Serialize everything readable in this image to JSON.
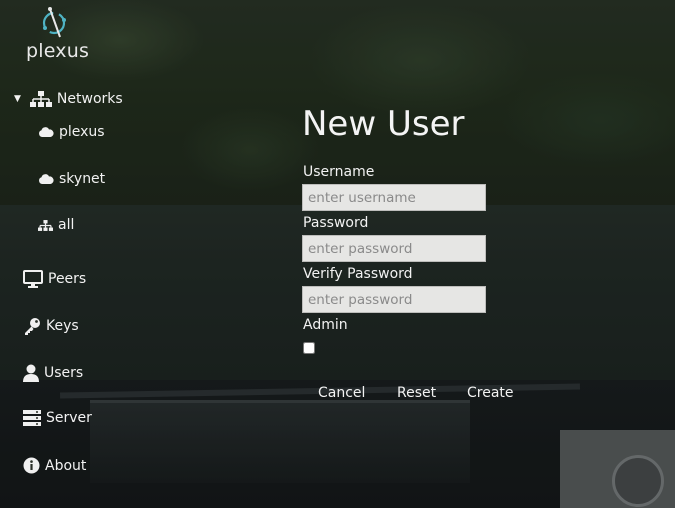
{
  "app": {
    "logo_text": "plexus"
  },
  "sidebar": {
    "networks": {
      "label": "Networks",
      "expanded": true,
      "children": [
        {
          "label": "plexus",
          "icon": "cloud-icon"
        },
        {
          "label": "skynet",
          "icon": "cloud-icon"
        },
        {
          "label": "all",
          "icon": "network-icon"
        }
      ]
    },
    "items": [
      {
        "label": "Peers",
        "icon": "monitor-icon"
      },
      {
        "label": "Keys",
        "icon": "key-icon"
      },
      {
        "label": "Users",
        "icon": "user-icon"
      },
      {
        "label": "Server",
        "icon": "server-icon"
      },
      {
        "label": "About",
        "icon": "info-icon"
      }
    ]
  },
  "form": {
    "title": "New User",
    "username": {
      "label": "Username",
      "placeholder": "enter username",
      "value": ""
    },
    "password": {
      "label": "Password",
      "placeholder": "enter password",
      "value": ""
    },
    "verify_password": {
      "label": "Verify Password",
      "placeholder": "enter password",
      "value": ""
    },
    "admin": {
      "label": "Admin",
      "checked": false
    },
    "buttons": {
      "cancel": "Cancel",
      "reset": "Reset",
      "create": "Create"
    }
  },
  "colors": {
    "accent": "#4fb3c4",
    "text": "#f2f2f2",
    "input_bg": "#e6e6e4"
  }
}
